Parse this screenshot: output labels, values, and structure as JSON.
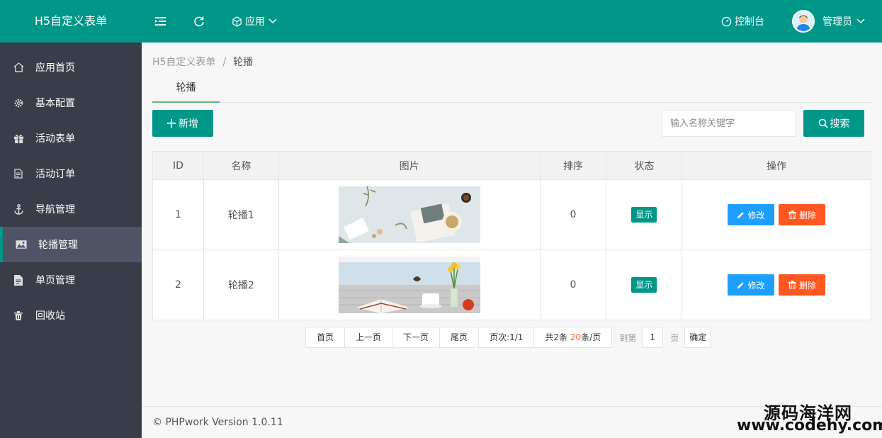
{
  "header": {
    "title": "H5自定义表单",
    "app_menu": "应用",
    "console": "控制台",
    "user": "管理员"
  },
  "sidebar": {
    "items": [
      {
        "label": "应用首页",
        "icon": "home-icon"
      },
      {
        "label": "基本配置",
        "icon": "gear-icon"
      },
      {
        "label": "活动表单",
        "icon": "gift-icon"
      },
      {
        "label": "活动订单",
        "icon": "document-icon"
      },
      {
        "label": "导航管理",
        "icon": "anchor-icon"
      },
      {
        "label": "轮播管理",
        "icon": "image-icon"
      },
      {
        "label": "单页管理",
        "icon": "file-icon"
      },
      {
        "label": "回收站",
        "icon": "trash-icon"
      }
    ],
    "active": "轮播管理"
  },
  "breadcrumb": {
    "parent": "H5自定义表单",
    "separator": "/",
    "current": "轮播"
  },
  "tab": "轮播",
  "toolbar": {
    "add_label": "新增",
    "search_placeholder": "输入名称关键字",
    "search_label": "搜索"
  },
  "table": {
    "columns": [
      "ID",
      "名称",
      "图片",
      "排序",
      "状态",
      "操作"
    ],
    "rows": [
      {
        "id": "1",
        "name": "轮播1",
        "sort": "0",
        "status": "显示",
        "edit": "修改",
        "delete": "删除"
      },
      {
        "id": "2",
        "name": "轮播2",
        "sort": "0",
        "status": "显示",
        "edit": "修改",
        "delete": "删除"
      }
    ]
  },
  "pagination": {
    "first": "首页",
    "prev": "上一页",
    "next": "下一页",
    "last": "尾页",
    "page_info_prefix": "页次:",
    "page_info_value": "1/1",
    "total_prefix": "共2条 ",
    "per_page_value": "20",
    "per_page_suffix": "条/页",
    "goto_label": "到第",
    "goto_value": "1",
    "page_unit": "页",
    "confirm": "确定"
  },
  "footer": {
    "copyright": "© PHPwork Version 1.0.11"
  },
  "watermark": {
    "line1": "源码海洋网",
    "line2": "www.codehy.com"
  },
  "colors": {
    "primary": "#009688",
    "sidebar": "#393d49",
    "edit": "#1E9FFF",
    "delete": "#FF5722",
    "tab_underline": "#5FB878"
  }
}
